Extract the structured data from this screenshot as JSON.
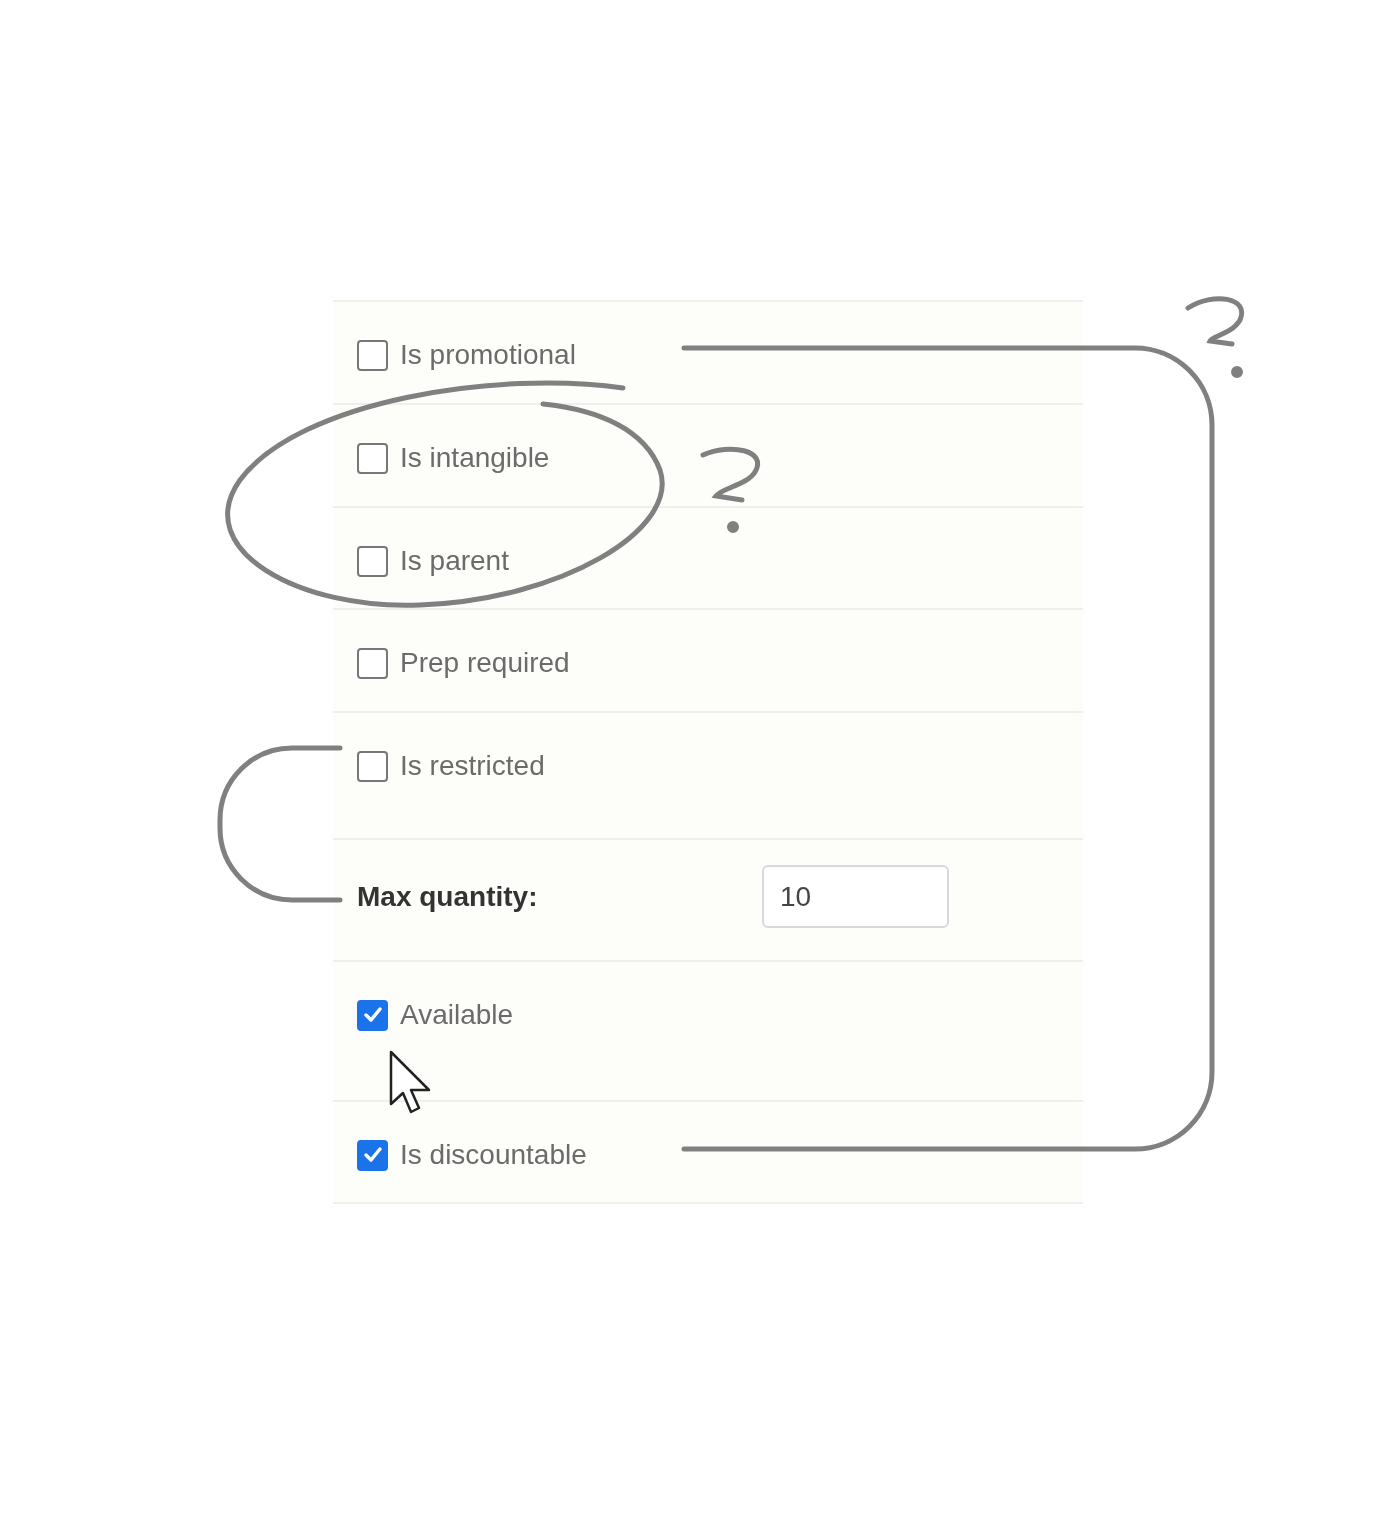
{
  "settings": [
    {
      "kind": "checkbox",
      "label": "Is promotional",
      "checked": false
    },
    {
      "kind": "checkbox",
      "label": "Is intangible",
      "checked": false
    },
    {
      "kind": "checkbox",
      "label": "Is parent",
      "checked": false
    },
    {
      "kind": "checkbox",
      "label": "Prep required",
      "checked": false
    },
    {
      "kind": "checkbox",
      "label": "Is restricted",
      "checked": false
    },
    {
      "kind": "number_field",
      "label": "Max quantity:",
      "value": "10"
    },
    {
      "kind": "checkbox",
      "label": "Available",
      "checked": true
    },
    {
      "kind": "checkbox",
      "label": "Is discountable",
      "checked": true
    }
  ]
}
